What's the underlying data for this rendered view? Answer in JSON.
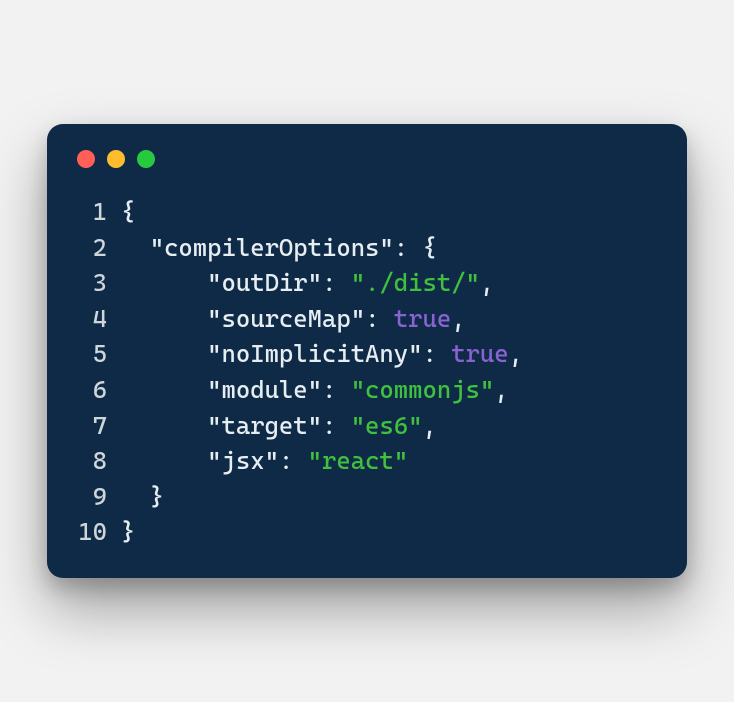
{
  "window": {
    "dots": {
      "red": "#ff5f56",
      "yellow": "#ffbd2e",
      "green": "#27c93f"
    }
  },
  "code": {
    "lines": [
      {
        "n": "1",
        "tokens": [
          {
            "cls": "punct",
            "t": "{"
          }
        ]
      },
      {
        "n": "2",
        "tokens": [
          {
            "cls": "txt",
            "t": "  "
          },
          {
            "cls": "key",
            "t": "\"compilerOptions\""
          },
          {
            "cls": "punct",
            "t": ": {"
          }
        ]
      },
      {
        "n": "3",
        "tokens": [
          {
            "cls": "txt",
            "t": "      "
          },
          {
            "cls": "key",
            "t": "\"outDir\""
          },
          {
            "cls": "punct",
            "t": ": "
          },
          {
            "cls": "str",
            "t": "\"./dist/\""
          },
          {
            "cls": "punct",
            "t": ","
          }
        ]
      },
      {
        "n": "4",
        "tokens": [
          {
            "cls": "txt",
            "t": "      "
          },
          {
            "cls": "key",
            "t": "\"sourceMap\""
          },
          {
            "cls": "punct",
            "t": ": "
          },
          {
            "cls": "bool",
            "t": "true"
          },
          {
            "cls": "punct",
            "t": ","
          }
        ]
      },
      {
        "n": "5",
        "tokens": [
          {
            "cls": "txt",
            "t": "      "
          },
          {
            "cls": "key",
            "t": "\"noImplicitAny\""
          },
          {
            "cls": "punct",
            "t": ": "
          },
          {
            "cls": "bool",
            "t": "true"
          },
          {
            "cls": "punct",
            "t": ","
          }
        ]
      },
      {
        "n": "6",
        "tokens": [
          {
            "cls": "txt",
            "t": "      "
          },
          {
            "cls": "key",
            "t": "\"module\""
          },
          {
            "cls": "punct",
            "t": ": "
          },
          {
            "cls": "str",
            "t": "\"commonjs\""
          },
          {
            "cls": "punct",
            "t": ","
          }
        ]
      },
      {
        "n": "7",
        "tokens": [
          {
            "cls": "txt",
            "t": "      "
          },
          {
            "cls": "key",
            "t": "\"target\""
          },
          {
            "cls": "punct",
            "t": ": "
          },
          {
            "cls": "str",
            "t": "\"es6\""
          },
          {
            "cls": "punct",
            "t": ","
          }
        ]
      },
      {
        "n": "8",
        "tokens": [
          {
            "cls": "txt",
            "t": "      "
          },
          {
            "cls": "key",
            "t": "\"jsx\""
          },
          {
            "cls": "punct",
            "t": ": "
          },
          {
            "cls": "str",
            "t": "\"react\""
          }
        ]
      },
      {
        "n": "9",
        "tokens": [
          {
            "cls": "txt",
            "t": "  "
          },
          {
            "cls": "punct",
            "t": "}"
          }
        ]
      },
      {
        "n": "10",
        "tokens": [
          {
            "cls": "punct",
            "t": "}"
          }
        ]
      }
    ]
  }
}
